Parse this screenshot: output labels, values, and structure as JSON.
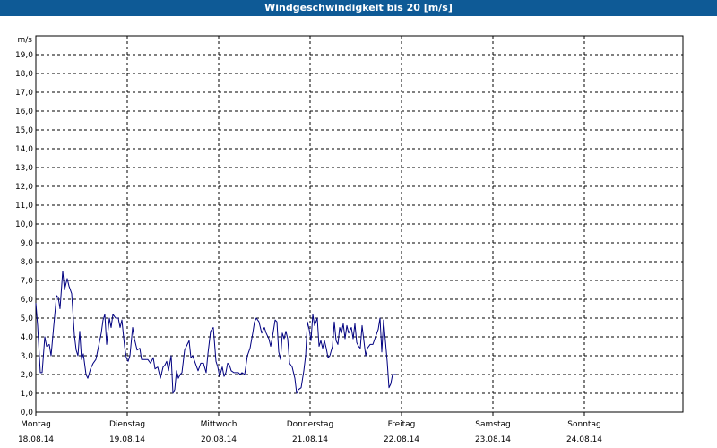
{
  "window": {
    "title": "Windgeschwindigkeit bis 20 [m/s]"
  },
  "chart_data": {
    "type": "line",
    "title": "Windgeschwindigkeit bis 20 [m/s]",
    "ylabel": "m/s",
    "xlabel": "",
    "ylim": [
      0,
      20
    ],
    "xlim": [
      0,
      7
    ],
    "grid": true,
    "y_ticks": [
      "0,0",
      "1,0",
      "2,0",
      "3,0",
      "4,0",
      "5,0",
      "6,0",
      "7,0",
      "8,0",
      "9,0",
      "10,0",
      "11,0",
      "12,0",
      "13,0",
      "14,0",
      "15,0",
      "16,0",
      "17,0",
      "18,0",
      "19,0"
    ],
    "x_ticks": [
      {
        "day": "Montag",
        "date": "18.08.14"
      },
      {
        "day": "Dienstag",
        "date": "19.08.14"
      },
      {
        "day": "Mittwoch",
        "date": "20.08.14"
      },
      {
        "day": "Donnerstag",
        "date": "21.08.14"
      },
      {
        "day": "Freitag",
        "date": "22.08.14"
      },
      {
        "day": "Samstag",
        "date": "23.08.14"
      },
      {
        "day": "Sonntag",
        "date": "24.08.14"
      }
    ],
    "series": [
      {
        "color": "#000080",
        "points": [
          [
            0.0,
            5.8
          ],
          [
            0.02,
            4.6
          ],
          [
            0.049,
            2.1
          ],
          [
            0.069,
            2.1
          ],
          [
            0.098,
            4.0
          ],
          [
            0.118,
            3.5
          ],
          [
            0.147,
            3.6
          ],
          [
            0.167,
            3.0
          ],
          [
            0.196,
            4.6
          ],
          [
            0.226,
            6.2
          ],
          [
            0.245,
            6.1
          ],
          [
            0.265,
            5.5
          ],
          [
            0.294,
            7.5
          ],
          [
            0.314,
            6.5
          ],
          [
            0.343,
            7.1
          ],
          [
            0.363,
            6.7
          ],
          [
            0.392,
            6.3
          ],
          [
            0.422,
            4.1
          ],
          [
            0.441,
            3.3
          ],
          [
            0.461,
            3.0
          ],
          [
            0.48,
            4.3
          ],
          [
            0.5,
            2.8
          ],
          [
            0.52,
            3.1
          ],
          [
            0.549,
            2.0
          ],
          [
            0.569,
            1.8
          ],
          [
            0.598,
            2.3
          ],
          [
            0.627,
            2.6
          ],
          [
            0.657,
            2.8
          ],
          [
            0.686,
            3.5
          ],
          [
            0.716,
            4.2
          ],
          [
            0.735,
            4.9
          ],
          [
            0.755,
            5.2
          ],
          [
            0.775,
            3.6
          ],
          [
            0.804,
            5.0
          ],
          [
            0.824,
            4.5
          ],
          [
            0.843,
            5.2
          ],
          [
            0.873,
            5.0
          ],
          [
            0.902,
            5.0
          ],
          [
            0.922,
            4.5
          ],
          [
            0.941,
            4.9
          ],
          [
            0.971,
            3.5
          ],
          [
            0.99,
            2.9
          ],
          [
            1.01,
            2.7
          ],
          [
            1.029,
            3.0
          ],
          [
            1.059,
            4.5
          ],
          [
            1.078,
            3.9
          ],
          [
            1.108,
            3.3
          ],
          [
            1.137,
            3.4
          ],
          [
            1.157,
            2.8
          ],
          [
            1.196,
            2.8
          ],
          [
            1.225,
            2.8
          ],
          [
            1.255,
            2.6
          ],
          [
            1.284,
            2.9
          ],
          [
            1.304,
            2.3
          ],
          [
            1.333,
            2.4
          ],
          [
            1.363,
            1.8
          ],
          [
            1.392,
            2.4
          ],
          [
            1.412,
            2.5
          ],
          [
            1.431,
            2.7
          ],
          [
            1.451,
            2.2
          ],
          [
            1.48,
            3.0
          ],
          [
            1.5,
            1.0
          ],
          [
            1.52,
            1.2
          ],
          [
            1.539,
            2.2
          ],
          [
            1.559,
            1.8
          ],
          [
            1.578,
            2.0
          ],
          [
            1.598,
            2.1
          ],
          [
            1.627,
            3.3
          ],
          [
            1.657,
            3.6
          ],
          [
            1.676,
            3.8
          ],
          [
            1.696,
            2.9
          ],
          [
            1.716,
            3.0
          ],
          [
            1.745,
            2.6
          ],
          [
            1.775,
            2.2
          ],
          [
            1.804,
            2.6
          ],
          [
            1.833,
            2.6
          ],
          [
            1.863,
            2.1
          ],
          [
            1.882,
            3.1
          ],
          [
            1.912,
            4.3
          ],
          [
            1.941,
            4.5
          ],
          [
            1.971,
            2.7
          ],
          [
            1.99,
            2.4
          ],
          [
            2.01,
            1.9
          ],
          [
            2.039,
            2.4
          ],
          [
            2.059,
            1.9
          ],
          [
            2.078,
            2.1
          ],
          [
            2.098,
            2.6
          ],
          [
            2.118,
            2.5
          ],
          [
            2.137,
            2.2
          ],
          [
            2.167,
            2.1
          ],
          [
            2.196,
            2.1
          ],
          [
            2.216,
            2.1
          ],
          [
            2.235,
            2.0
          ],
          [
            2.255,
            2.1
          ],
          [
            2.284,
            2.0
          ],
          [
            2.314,
            3.0
          ],
          [
            2.343,
            3.4
          ],
          [
            2.373,
            4.2
          ],
          [
            2.392,
            4.8
          ],
          [
            2.412,
            5.0
          ],
          [
            2.441,
            4.8
          ],
          [
            2.471,
            4.2
          ],
          [
            2.5,
            4.5
          ],
          [
            2.52,
            4.2
          ],
          [
            2.549,
            3.9
          ],
          [
            2.569,
            3.5
          ],
          [
            2.588,
            4.0
          ],
          [
            2.618,
            4.9
          ],
          [
            2.637,
            4.8
          ],
          [
            2.657,
            3.2
          ],
          [
            2.676,
            2.8
          ],
          [
            2.696,
            4.2
          ],
          [
            2.716,
            3.9
          ],
          [
            2.735,
            4.3
          ],
          [
            2.755,
            3.9
          ],
          [
            2.775,
            2.6
          ],
          [
            2.804,
            2.4
          ],
          [
            2.833,
            1.8
          ],
          [
            2.853,
            1.0
          ],
          [
            2.873,
            1.2
          ],
          [
            2.902,
            1.3
          ],
          [
            2.931,
            2.2
          ],
          [
            2.951,
            3.0
          ],
          [
            2.971,
            4.8
          ],
          [
            2.99,
            4.4
          ],
          [
            3.01,
            3.8
          ],
          [
            3.029,
            5.2
          ],
          [
            3.049,
            4.6
          ],
          [
            3.078,
            5.0
          ],
          [
            3.098,
            3.5
          ],
          [
            3.118,
            3.8
          ],
          [
            3.137,
            3.4
          ],
          [
            3.157,
            3.8
          ],
          [
            3.176,
            3.4
          ],
          [
            3.196,
            2.9
          ],
          [
            3.216,
            3.0
          ],
          [
            3.245,
            3.5
          ],
          [
            3.265,
            4.8
          ],
          [
            3.284,
            3.8
          ],
          [
            3.304,
            3.6
          ],
          [
            3.324,
            4.5
          ],
          [
            3.343,
            4.2
          ],
          [
            3.363,
            4.7
          ],
          [
            3.382,
            3.9
          ],
          [
            3.402,
            4.6
          ],
          [
            3.422,
            4.2
          ],
          [
            3.451,
            4.5
          ],
          [
            3.471,
            3.9
          ],
          [
            3.49,
            4.7
          ],
          [
            3.51,
            3.7
          ],
          [
            3.529,
            3.5
          ],
          [
            3.549,
            3.4
          ],
          [
            3.569,
            4.6
          ],
          [
            3.588,
            3.8
          ],
          [
            3.608,
            3.0
          ],
          [
            3.627,
            3.4
          ],
          [
            3.657,
            3.6
          ],
          [
            3.686,
            3.6
          ],
          [
            3.716,
            4.0
          ],
          [
            3.745,
            4.4
          ],
          [
            3.765,
            5.0
          ],
          [
            3.784,
            3.2
          ],
          [
            3.804,
            4.9
          ],
          [
            3.824,
            3.8
          ],
          [
            3.843,
            2.7
          ],
          [
            3.863,
            1.3
          ],
          [
            3.882,
            1.5
          ],
          [
            3.902,
            2.0
          ],
          [
            3.922,
            2.0
          ],
          [
            3.941,
            2.0
          ]
        ]
      }
    ]
  }
}
